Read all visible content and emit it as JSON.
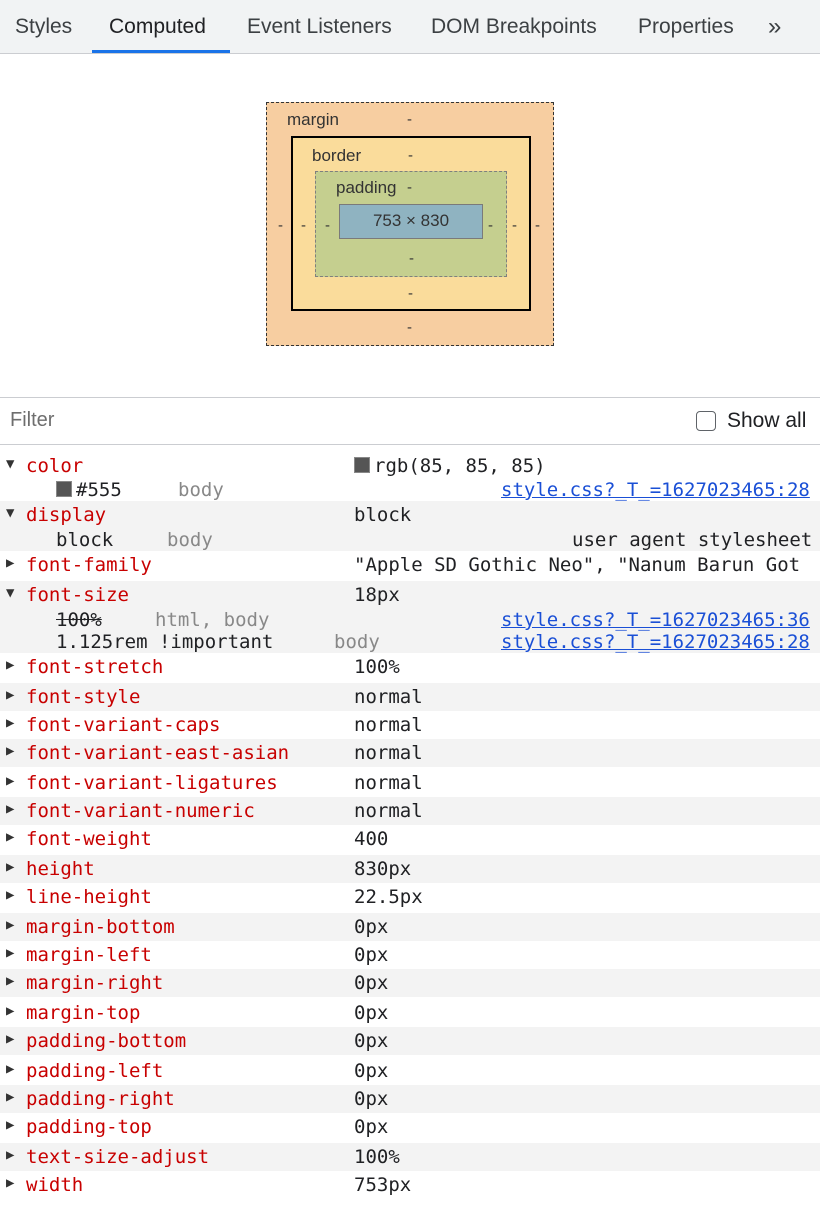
{
  "tabs": [
    {
      "label": "Styles"
    },
    {
      "label": "Computed"
    },
    {
      "label": "Event Listeners"
    },
    {
      "label": "DOM Breakpoints"
    },
    {
      "label": "Properties"
    }
  ],
  "tabs_more": "»",
  "box_model": {
    "margin_label": "margin",
    "border_label": "border",
    "padding_label": "padding",
    "content": "753 × 830",
    "dash": "-"
  },
  "filter": {
    "placeholder": "Filter",
    "show_all_label": "Show all",
    "show_all_checked": false
  },
  "properties": [
    {
      "name": "color",
      "value": "rgb(85, 85, 85)",
      "expanded": true,
      "swatch": "#555555",
      "subs": [
        {
          "value": "#555",
          "selector": "body",
          "source": "style.css?_T_=1627023465:28",
          "swatch": "#555555"
        }
      ]
    },
    {
      "name": "display",
      "value": "block",
      "expanded": true,
      "subs": [
        {
          "value": "block",
          "selector": "body",
          "source": "user agent stylesheet"
        }
      ]
    },
    {
      "name": "font-family",
      "value": "\"Apple SD Gothic Neo\", \"Nanum Barun Got"
    },
    {
      "name": "font-size",
      "value": "18px",
      "expanded": true,
      "subs": [
        {
          "value": "100%",
          "selector": "html, body",
          "source": "style.css?_T_=1627023465:36",
          "overridden": true
        },
        {
          "value": "1.125rem !important",
          "selector": "body",
          "source": "style.css?_T_=1627023465:28"
        }
      ]
    },
    {
      "name": "font-stretch",
      "value": "100%"
    },
    {
      "name": "font-style",
      "value": "normal"
    },
    {
      "name": "font-variant-caps",
      "value": "normal"
    },
    {
      "name": "font-variant-east-asian",
      "value": "normal"
    },
    {
      "name": "font-variant-ligatures",
      "value": "normal"
    },
    {
      "name": "font-variant-numeric",
      "value": "normal"
    },
    {
      "name": "font-weight",
      "value": "400"
    },
    {
      "name": "height",
      "value": "830px"
    },
    {
      "name": "line-height",
      "value": "22.5px"
    },
    {
      "name": "margin-bottom",
      "value": "0px"
    },
    {
      "name": "margin-left",
      "value": "0px"
    },
    {
      "name": "margin-right",
      "value": "0px"
    },
    {
      "name": "margin-top",
      "value": "0px"
    },
    {
      "name": "padding-bottom",
      "value": "0px"
    },
    {
      "name": "padding-left",
      "value": "0px"
    },
    {
      "name": "padding-right",
      "value": "0px"
    },
    {
      "name": "padding-top",
      "value": "0px"
    },
    {
      "name": "text-size-adjust",
      "value": "100%"
    },
    {
      "name": "width",
      "value": "753px"
    }
  ],
  "colors": {
    "accent": "#1a73e8",
    "property_name": "#c80000",
    "link": "#1a4fd6"
  }
}
